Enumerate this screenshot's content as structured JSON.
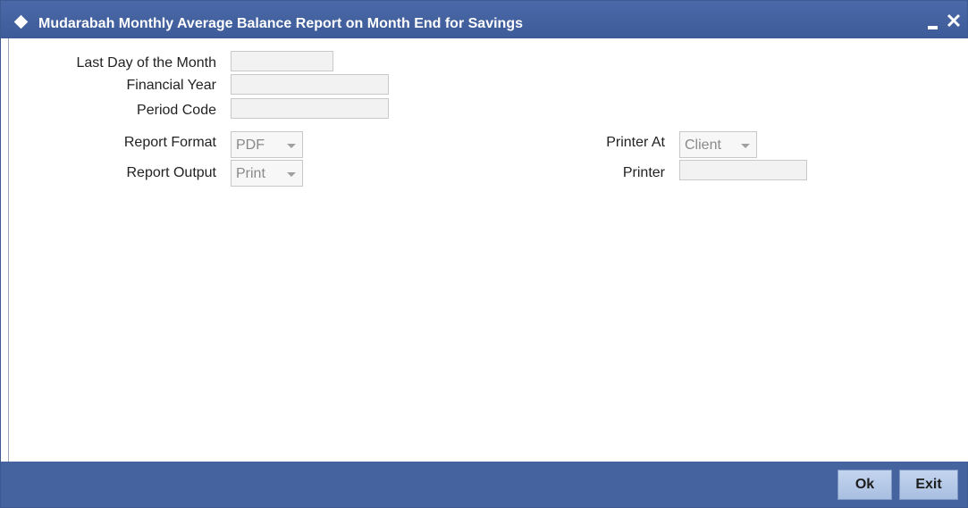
{
  "window": {
    "title": "Mudarabah Monthly Average Balance Report on Month End for Savings"
  },
  "form": {
    "last_day_label": "Last Day of the Month",
    "last_day_value": "",
    "financial_year_label": "Financial Year",
    "financial_year_value": "",
    "period_code_label": "Period Code",
    "period_code_value": "",
    "report_format_label": "Report Format",
    "report_format_value": "PDF",
    "report_output_label": "Report Output",
    "report_output_value": "Print",
    "printer_at_label": "Printer At",
    "printer_at_value": "Client",
    "printer_label": "Printer",
    "printer_value": ""
  },
  "footer": {
    "ok_label": "Ok",
    "exit_label": "Exit"
  },
  "icons": {
    "title": "diamond-icon",
    "minimize": "minimize-icon",
    "close": "close-icon",
    "dropdown": "chevron-down-icon"
  },
  "colors": {
    "titlebar": "#4466a3",
    "footer": "#44639f",
    "button": "#b4c8e8"
  }
}
